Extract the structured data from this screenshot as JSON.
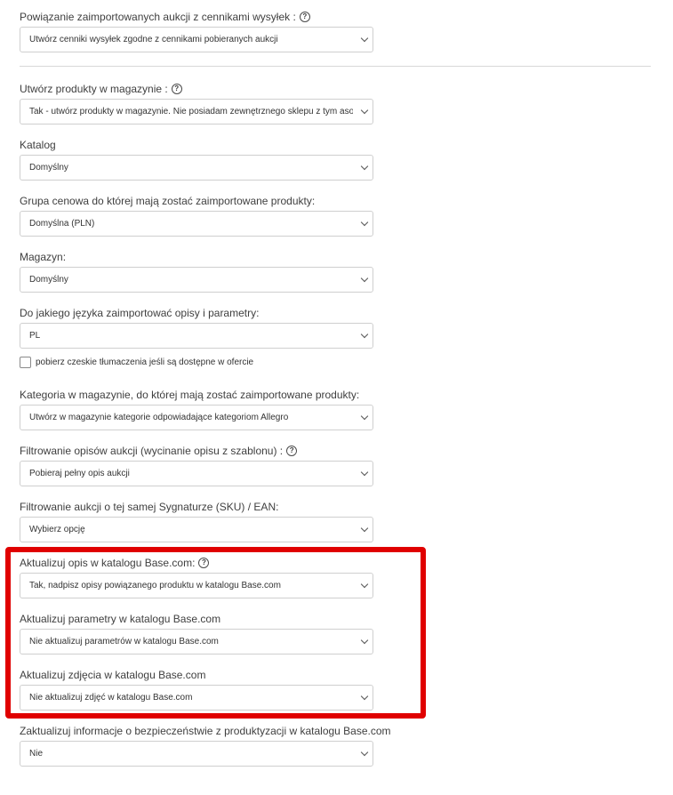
{
  "fields": [
    {
      "label": "Powiązanie zaimportowanych aukcji z cennikami wysyłek :",
      "help": true,
      "value": "Utwórz cenniki wysyłek zgodne z cennikami pobieranych aukcji"
    },
    {
      "label": "Utwórz produkty w magazynie :",
      "help": true,
      "value": "Tak - utwórz produkty w magazynie. Nie posiadam zewnętrznego sklepu z tym asortymentem"
    },
    {
      "label": "Katalog",
      "help": false,
      "value": "Domyślny"
    },
    {
      "label": "Grupa cenowa do której mają zostać zaimportowane produkty:",
      "help": false,
      "value": "Domyślna (PLN)"
    },
    {
      "label": "Magazyn:",
      "help": false,
      "value": "Domyślny"
    },
    {
      "label": "Do jakiego języka zaimportować opisy i parametry:",
      "help": false,
      "value": "PL"
    },
    {
      "label": "Kategoria w magazynie, do której mają zostać zaimportowane produkty:",
      "help": false,
      "value": "Utwórz w magazynie kategorie odpowiadające kategoriom Allegro"
    },
    {
      "label": "Filtrowanie opisów aukcji (wycinanie opisu z szablonu) :",
      "help": true,
      "value": "Pobieraj pełny opis aukcji"
    },
    {
      "label": "Filtrowanie aukcji o tej samej Sygnaturze (SKU) / EAN:",
      "help": false,
      "value": "Wybierz opcję"
    },
    {
      "label": "Aktualizuj opis w katalogu Base.com:",
      "help": true,
      "value": "Tak, nadpisz opisy powiązanego produktu w katalogu Base.com"
    },
    {
      "label": "Aktualizuj parametry w katalogu Base.com",
      "help": false,
      "value": "Nie aktualizuj parametrów w katalogu Base.com"
    },
    {
      "label": "Aktualizuj zdjęcia w katalogu Base.com",
      "help": false,
      "value": "Nie aktualizuj zdjęć w katalogu Base.com"
    },
    {
      "label": "Zaktualizuj informacje o bezpieczeństwie z produktyzacji w katalogu Base.com",
      "help": false,
      "value": "Nie"
    }
  ],
  "checkbox": {
    "label": "pobierz czeskie tłumaczenia jeśli są dostępne w ofercie",
    "checked": false
  },
  "help_icon_glyph": "?",
  "highlight_color": "#e00000"
}
